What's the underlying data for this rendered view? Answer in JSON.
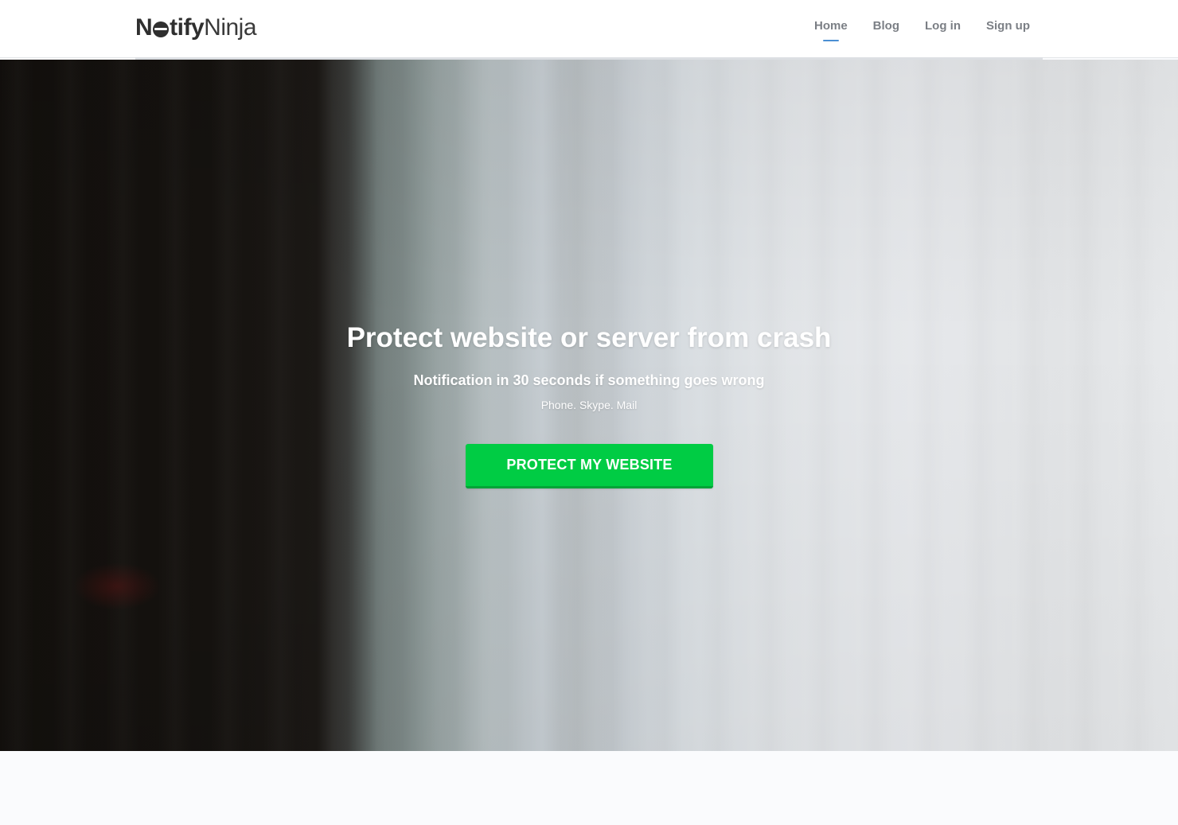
{
  "header": {
    "logo": {
      "bold_prefix": "N",
      "bold_suffix": "tify",
      "light": "Ninja"
    },
    "nav": [
      {
        "label": "Home",
        "active": true
      },
      {
        "label": "Blog",
        "active": false
      },
      {
        "label": "Log in",
        "active": false
      },
      {
        "label": "Sign up",
        "active": false
      }
    ]
  },
  "hero": {
    "title": "Protect website or server from crash",
    "subtitle": "Notification in 30 seconds if something goes wrong",
    "channels": "Phone. Skype. Mail",
    "cta_label": "PROTECT MY WEBSITE"
  },
  "colors": {
    "cta": "#00cc44",
    "nav_active_underline": "#4a8fd3",
    "nav_text": "#7b7f85"
  }
}
